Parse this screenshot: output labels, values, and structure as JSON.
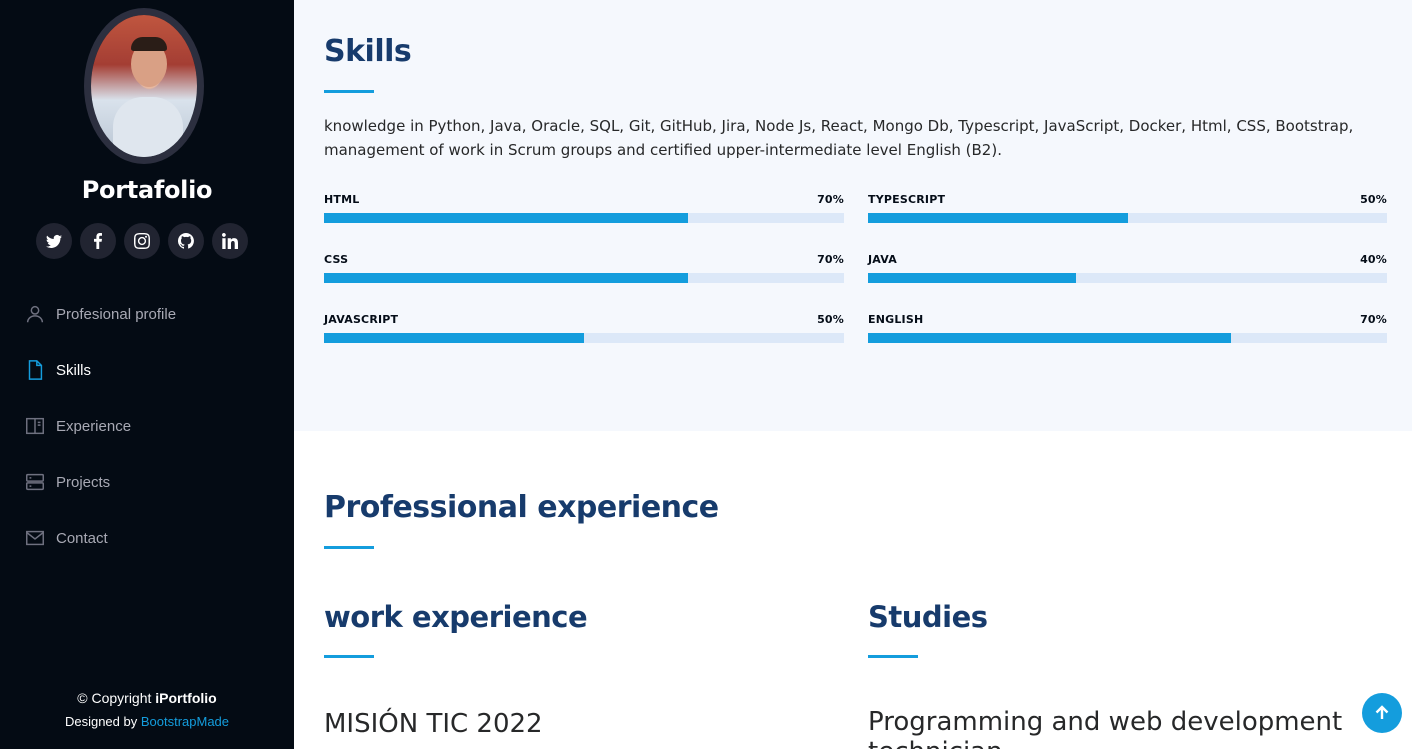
{
  "sidebar": {
    "brand": "Portafolio",
    "social": [
      {
        "icon": "twitter-icon"
      },
      {
        "icon": "facebook-icon"
      },
      {
        "icon": "instagram-icon"
      },
      {
        "icon": "github-icon"
      },
      {
        "icon": "linkedin-icon"
      }
    ],
    "nav": [
      {
        "label": "Profesional profile",
        "icon": "person-icon",
        "active": false
      },
      {
        "label": "Skills",
        "icon": "file-icon",
        "active": true
      },
      {
        "label": "Experience",
        "icon": "book-icon",
        "active": false
      },
      {
        "label": "Projects",
        "icon": "server-icon",
        "active": false
      },
      {
        "label": "Contact",
        "icon": "envelope-icon",
        "active": false
      }
    ],
    "footer": {
      "copyright_prefix": "© Copyright ",
      "copyright_brand": "iPortfolio",
      "designed_prefix": "Designed by ",
      "designed_link": "BootstrapMade"
    }
  },
  "skills": {
    "title": "Skills",
    "description": "knowledge in Python, Java, Oracle, SQL, Git, GitHub, Jira, Node Js, React, Mongo Db, Typescript, JavaScript, Docker, Html, CSS, Bootstrap, management of work in Scrum groups and certified upper-intermediate level English (B2).",
    "items": [
      {
        "name": "HTML",
        "percent_label": "70%",
        "value": 70
      },
      {
        "name": "TYPESCRIPT",
        "percent_label": "50%",
        "value": 50
      },
      {
        "name": "CSS",
        "percent_label": "70%",
        "value": 70
      },
      {
        "name": "JAVA",
        "percent_label": "40%",
        "value": 40
      },
      {
        "name": "JAVASCRIPT",
        "percent_label": "50%",
        "value": 50
      },
      {
        "name": "ENGLISH",
        "percent_label": "70%",
        "value": 70
      }
    ]
  },
  "experience": {
    "title": "Professional experience",
    "work": {
      "title": "work experience",
      "first_item": "MISIÓN TIC 2022"
    },
    "studies": {
      "title": "Studies",
      "first_item": "Programming and web development technician"
    }
  },
  "colors": {
    "accent": "#149ddd",
    "heading": "#173b6c",
    "sidebar_bg": "#040b14"
  }
}
